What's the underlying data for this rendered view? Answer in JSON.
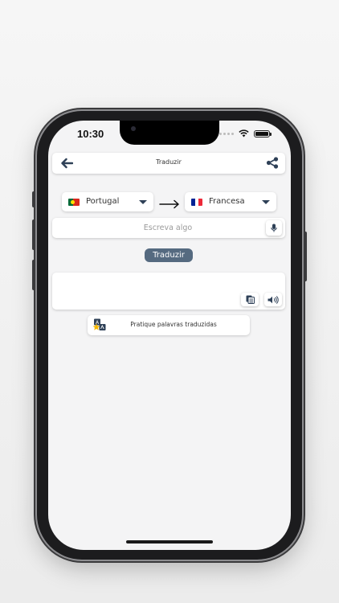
{
  "status_bar": {
    "time": "10:30"
  },
  "header": {
    "title": "Traduzir",
    "back_icon": "arrow-left-icon",
    "share_icon": "share-icon"
  },
  "languages": {
    "from": {
      "label": "Portugal",
      "flag_colors": [
        "#046a38",
        "#da291c"
      ]
    },
    "to": {
      "label": "Francesa",
      "flag_colors": [
        "#002395",
        "#ffffff",
        "#ed2939"
      ]
    }
  },
  "input": {
    "placeholder": "Escreva algo",
    "value": ""
  },
  "translate_button": {
    "label": "Traduzir",
    "color": "#556a80"
  },
  "output": {
    "text": ""
  },
  "practice": {
    "label": "Pratique palavras traduzidas"
  },
  "colors": {
    "accent": "#2e4057",
    "screen_bg": "#f4f4f5"
  }
}
